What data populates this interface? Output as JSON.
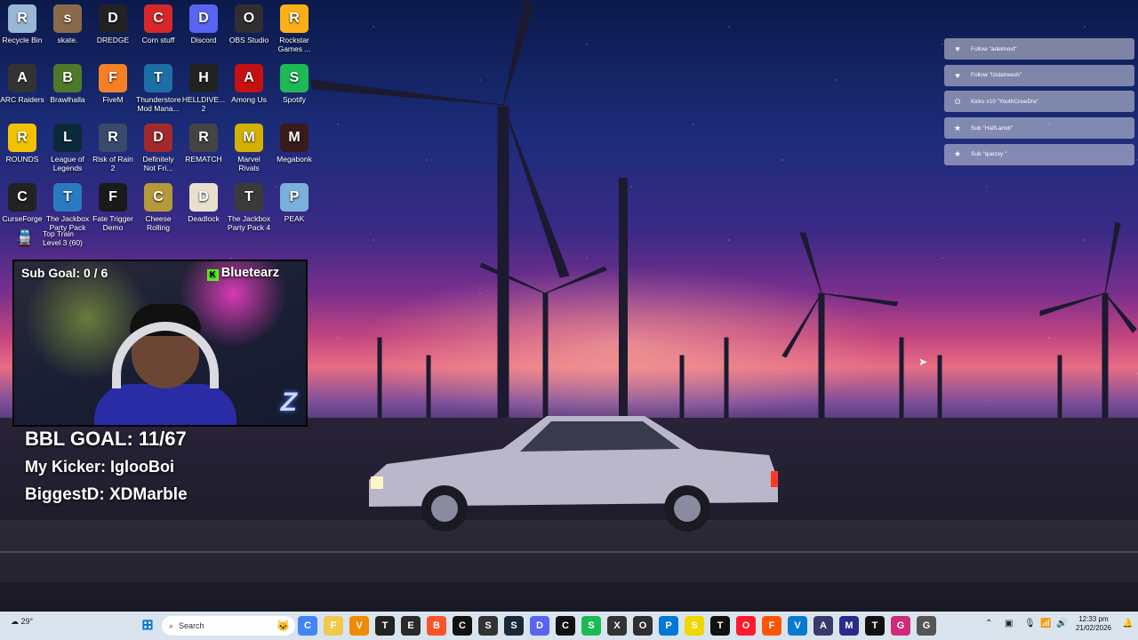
{
  "desktop_icons": [
    {
      "label": "Recycle Bin",
      "icon": "recycle-bin-icon",
      "color": "#9ab7d6"
    },
    {
      "label": "skate.",
      "icon": "skate-icon",
      "color": "#8a6a4a"
    },
    {
      "label": "DREDGE",
      "icon": "dredge-icon",
      "color": "#222222"
    },
    {
      "label": "Corn stuff",
      "icon": "corn-stuff-icon",
      "color": "#d62828"
    },
    {
      "label": "Discord",
      "icon": "discord-icon",
      "color": "#5865f2"
    },
    {
      "label": "OBS Studio",
      "icon": "obs-icon",
      "color": "#302e31"
    },
    {
      "label": "Rockstar Games ...",
      "icon": "rockstar-icon",
      "color": "#fcaf17"
    },
    {
      "label": "ARC Raiders",
      "icon": "arc-raiders-icon",
      "color": "#333333"
    },
    {
      "label": "Brawlhalla",
      "icon": "brawlhalla-icon",
      "color": "#4d7a2a"
    },
    {
      "label": "FiveM",
      "icon": "fivem-icon",
      "color": "#f58025"
    },
    {
      "label": "Thunderstore Mod Mana...",
      "icon": "thunderstore-icon",
      "color": "#1c6ea4"
    },
    {
      "label": "HELLDIVE... 2",
      "icon": "helldivers-icon",
      "color": "#222222"
    },
    {
      "label": "Among Us",
      "icon": "among-us-icon",
      "color": "#c51111"
    },
    {
      "label": "Spotify",
      "icon": "spotify-icon",
      "color": "#1db954"
    },
    {
      "label": "ROUNDS",
      "icon": "rounds-icon",
      "color": "#f2c200"
    },
    {
      "label": "League of Legends",
      "icon": "league-icon",
      "color": "#0a2a3a"
    },
    {
      "label": "Risk of Rain 2",
      "icon": "risk-of-rain-icon",
      "color": "#3a4a6a"
    },
    {
      "label": "Definitely Not Fri...",
      "icon": "definitely-not-fried-icon",
      "color": "#a32a2a"
    },
    {
      "label": "REMATCH",
      "icon": "rematch-icon",
      "color": "#444444"
    },
    {
      "label": "Marvel Rivals",
      "icon": "marvel-rivals-icon",
      "color": "#d4b100"
    },
    {
      "label": "Megabonk",
      "icon": "megabonk-icon",
      "color": "#3a1a1a"
    },
    {
      "label": "CurseForge",
      "icon": "curseforge-icon",
      "color": "#222222"
    },
    {
      "label": "The Jackbox Party Pack",
      "icon": "jackbox-icon",
      "color": "#2a7ac0"
    },
    {
      "label": "Fate Trigger Demo",
      "icon": "fate-trigger-icon",
      "color": "#1a1a1a"
    },
    {
      "label": "Cheese Rolling",
      "icon": "cheese-rolling-icon",
      "color": "#b49a3a"
    },
    {
      "label": "Deadlock",
      "icon": "deadlock-icon",
      "color": "#e8e0cc"
    },
    {
      "label": "The Jackbox Party Pack 4",
      "icon": "jackbox-4-icon",
      "color": "#3a3a3a"
    },
    {
      "label": "PEAK",
      "icon": "peak-icon",
      "color": "#7ab0d9"
    }
  ],
  "top_train": {
    "title": "Top Train",
    "level": "Level 3 (60)",
    "icon": "train-icon"
  },
  "alerts": [
    {
      "type": "heart-icon",
      "text": "Follow \"adelmovt\""
    },
    {
      "type": "heart-icon",
      "text": "Follow \"Izidatreesh\""
    },
    {
      "type": "kick-icon",
      "text": "Kicks x10 \"YouthCrewDre\""
    },
    {
      "type": "star-icon",
      "text": "Sub \"HaifLamdi\""
    },
    {
      "type": "star-icon",
      "text": "Sub \"quezxy \""
    }
  ],
  "webcam": {
    "sub_goal": "Sub Goal: 0 / 6",
    "handle": "Bluetearz",
    "kick_logo": "K"
  },
  "overlay": {
    "bbl_goal": "BBL GOAL: 11/67",
    "kicker": "My Kicker: IglooBoi",
    "biggest": "BiggestD: XDMarble"
  },
  "taskbar": {
    "weather": "29°",
    "search_placeholder": "Search",
    "apps": [
      {
        "name": "chrome-icon",
        "color": "#4285f4"
      },
      {
        "name": "file-explorer-icon",
        "color": "#f2c94c"
      },
      {
        "name": "vlc-icon",
        "color": "#f08a00"
      },
      {
        "name": "terminal-icon",
        "color": "#222222"
      },
      {
        "name": "epic-games-icon",
        "color": "#2a2a2a"
      },
      {
        "name": "brave-icon",
        "color": "#fb542b"
      },
      {
        "name": "capcut-icon",
        "color": "#111111"
      },
      {
        "name": "settings-app-icon",
        "color": "#333333"
      },
      {
        "name": "steam-icon",
        "color": "#1b2838"
      },
      {
        "name": "discord-icon",
        "color": "#5865f2"
      },
      {
        "name": "capcut-2-icon",
        "color": "#111111"
      },
      {
        "name": "spotify-icon",
        "color": "#1db954"
      },
      {
        "name": "xbox-icon",
        "color": "#333333"
      },
      {
        "name": "obs-icon",
        "color": "#302e31"
      },
      {
        "name": "photos-icon",
        "color": "#0078d4"
      },
      {
        "name": "sticky-notes-icon",
        "color": "#f2d600"
      },
      {
        "name": "terminal-2-icon",
        "color": "#111111"
      },
      {
        "name": "opera-icon",
        "color": "#ff1b2d"
      },
      {
        "name": "faceit-icon",
        "color": "#ff5500"
      },
      {
        "name": "vs-code-icon",
        "color": "#0a7acc"
      },
      {
        "name": "app-icon",
        "color": "#3a3a6a"
      },
      {
        "name": "medal-icon",
        "color": "#2a2a8a"
      },
      {
        "name": "tiktok-icon",
        "color": "#111111"
      },
      {
        "name": "game-icon",
        "color": "#d02a7a"
      },
      {
        "name": "gear-icon",
        "color": "#555555"
      }
    ],
    "time": "12:33 pm",
    "date": "21/02/2026"
  }
}
